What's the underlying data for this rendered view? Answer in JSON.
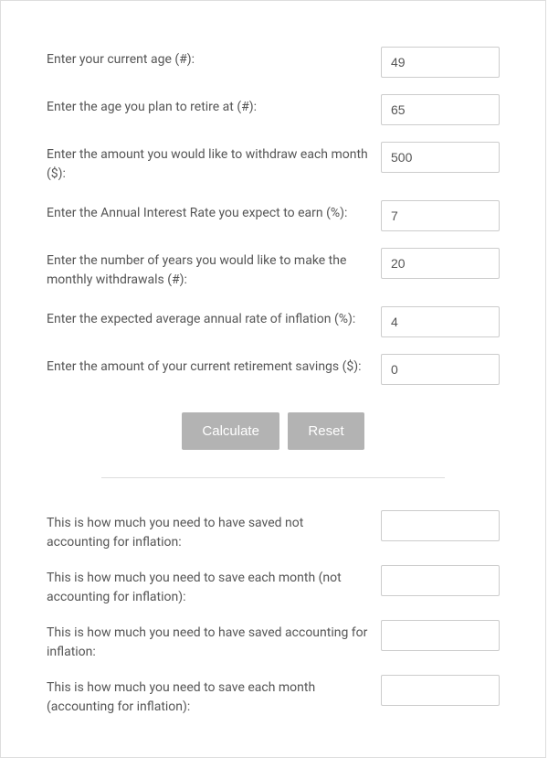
{
  "inputs": {
    "current_age": {
      "label": "Enter your current age (#):",
      "value": "49"
    },
    "retire_age": {
      "label": "Enter the age you plan to retire at (#):",
      "value": "65"
    },
    "withdraw_amount": {
      "label": "Enter the amount you would like to withdraw each month ($):",
      "value": "500"
    },
    "interest_rate": {
      "label": "Enter the Annual Interest Rate you expect to earn (%):",
      "value": "7"
    },
    "years_withdraw": {
      "label": "Enter the number of years you would like to make the monthly withdrawals (#):",
      "value": "20"
    },
    "inflation_rate": {
      "label": "Enter the expected average annual rate of inflation (%):",
      "value": "4"
    },
    "current_savings": {
      "label": "Enter the amount of your current retirement savings ($):",
      "value": "0"
    }
  },
  "buttons": {
    "calculate": "Calculate",
    "reset": "Reset"
  },
  "outputs": {
    "saved_no_inflation": {
      "label": "This is how much you need to have saved not accounting for inflation:",
      "value": ""
    },
    "monthly_no_inflation": {
      "label": "This is how much you need to save each month (not accounting for inflation):",
      "value": ""
    },
    "saved_with_inflation": {
      "label": "This is how much you need to have saved accounting for inflation:",
      "value": ""
    },
    "monthly_with_inflation": {
      "label": "This is how much you need to save each month (accounting for inflation):",
      "value": ""
    }
  }
}
